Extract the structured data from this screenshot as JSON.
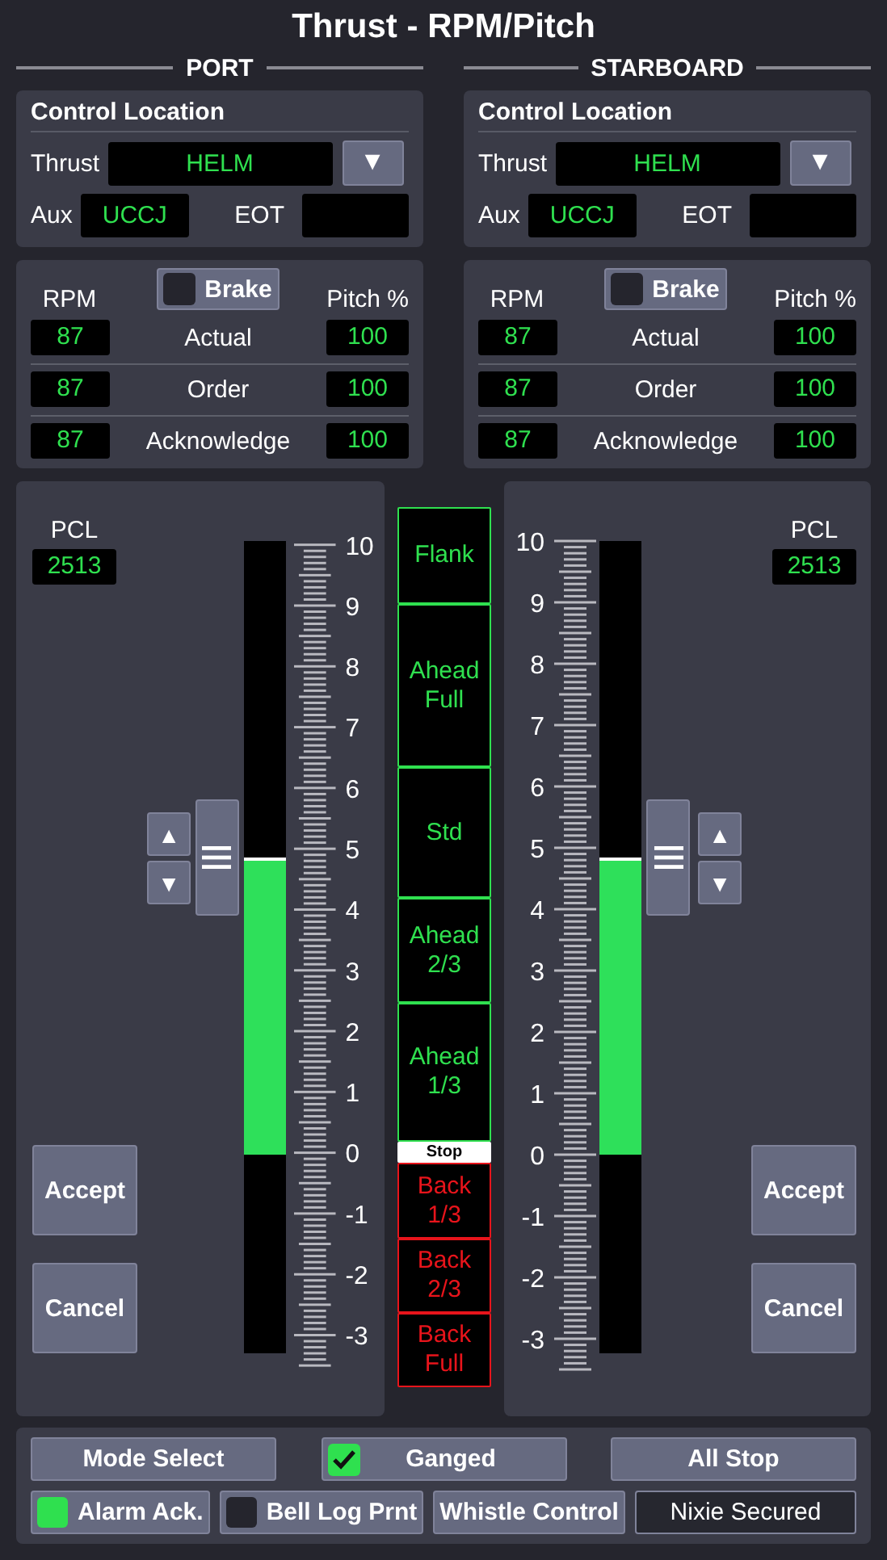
{
  "title": "Thrust - RPM/Pitch",
  "sides": [
    {
      "heading": "PORT",
      "control_location": {
        "title": "Control Location",
        "thrust_label": "Thrust",
        "thrust_value": "HELM",
        "dropdown": "▼",
        "aux_label": "Aux",
        "aux_value": "UCCJ",
        "eot_label": "EOT"
      },
      "rpm_pitch": {
        "rpm_heading": "RPM",
        "pitch_heading": "Pitch %",
        "brake": {
          "label": "Brake",
          "checked": false
        },
        "rows": [
          {
            "label": "Actual",
            "rpm": "87",
            "pitch": "100"
          },
          {
            "label": "Order",
            "rpm": "87",
            "pitch": "100"
          },
          {
            "label": "Acknowledge",
            "rpm": "87",
            "pitch": "100"
          }
        ]
      },
      "lever": {
        "pcl_label": "PCL",
        "pcl_value": "2513",
        "level": 0.61,
        "up": "▲",
        "down": "▼",
        "accept": "Accept",
        "cancel": "Cancel",
        "scale_labels": [
          "10",
          "9",
          "8",
          "7",
          "6",
          "5",
          "4",
          "3",
          "2",
          "1",
          "0",
          "-1",
          "-2",
          "-3"
        ]
      }
    },
    {
      "heading": "STARBOARD",
      "control_location": {
        "title": "Control Location",
        "thrust_label": "Thrust",
        "thrust_value": "HELM",
        "dropdown": "▼",
        "aux_label": "Aux",
        "aux_value": "UCCJ",
        "eot_label": "EOT"
      },
      "rpm_pitch": {
        "rpm_heading": "RPM",
        "pitch_heading": "Pitch %",
        "brake": {
          "label": "Brake",
          "checked": false
        },
        "rows": [
          {
            "label": "Actual",
            "rpm": "87",
            "pitch": "100"
          },
          {
            "label": "Order",
            "rpm": "87",
            "pitch": "100"
          },
          {
            "label": "Acknowledge",
            "rpm": "87",
            "pitch": "100"
          }
        ]
      },
      "lever": {
        "pcl_label": "PCL",
        "pcl_value": "2513",
        "level": 0.61,
        "up": "▲",
        "down": "▼",
        "accept": "Accept",
        "cancel": "Cancel",
        "scale_labels": [
          "10",
          "9",
          "8",
          "7",
          "6",
          "5",
          "4",
          "3",
          "2",
          "1",
          "0",
          "-1",
          "-2",
          "-3"
        ]
      }
    }
  ],
  "telegraph": [
    {
      "label": "Flank",
      "kind": "ahead"
    },
    {
      "label": "Ahead Full",
      "kind": "ahead"
    },
    {
      "label": "Std",
      "kind": "ahead"
    },
    {
      "label": "Ahead 2/3",
      "kind": "ahead"
    },
    {
      "label": "Ahead 1/3",
      "kind": "ahead"
    },
    {
      "label": "Stop",
      "kind": "stop"
    },
    {
      "label": "Back 1/3",
      "kind": "astern"
    },
    {
      "label": "Back 2/3",
      "kind": "astern"
    },
    {
      "label": "Back Full",
      "kind": "astern"
    }
  ],
  "bottom": {
    "row_1": [
      {
        "kind": "button",
        "label": "Mode Select"
      },
      {
        "kind": "toggle",
        "label": "Ganged",
        "checked": true
      },
      {
        "kind": "button",
        "label": "All Stop"
      }
    ],
    "row_2": [
      {
        "kind": "indicator",
        "label": "Alarm Ack.",
        "checked": true
      },
      {
        "kind": "indicator",
        "label": "Bell Log Prnt",
        "checked": false
      },
      {
        "kind": "button",
        "label": "Whistle Control"
      },
      {
        "kind": "status",
        "label": "Nixie Secured"
      }
    ]
  }
}
